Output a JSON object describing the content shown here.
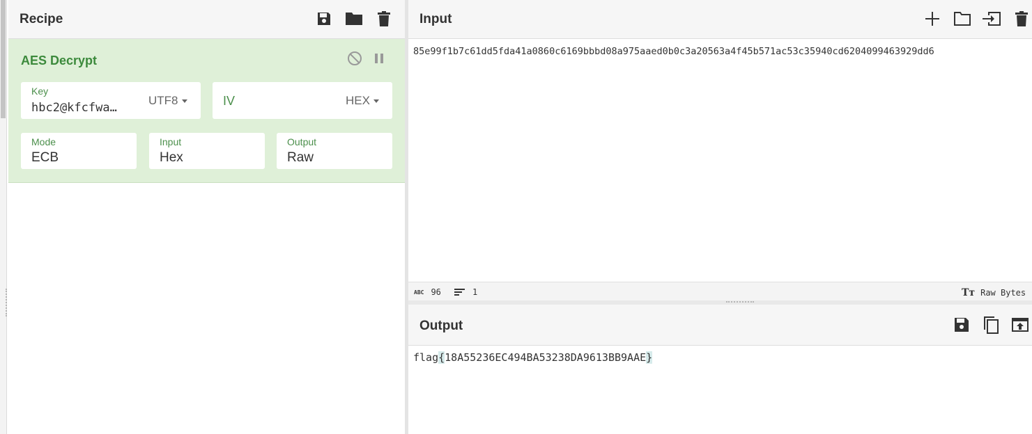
{
  "recipe": {
    "title": "Recipe",
    "icons": [
      "save-icon",
      "folder-icon",
      "trash-icon"
    ],
    "operation": {
      "title": "AES Decrypt",
      "key": {
        "label": "Key",
        "value": "hbc2@kfcfwa…",
        "encoding": "UTF8"
      },
      "iv": {
        "label": "IV",
        "encoding": "HEX"
      },
      "mode": {
        "label": "Mode",
        "value": "ECB"
      },
      "input": {
        "label": "Input",
        "value": "Hex"
      },
      "output": {
        "label": "Output",
        "value": "Raw"
      },
      "accent_color": "#3c8a3c",
      "background_color": "#dff0d8"
    }
  },
  "input": {
    "title": "Input",
    "text": "85e99f1b7c61dd5fda41a0860c6169bbbd08a975aaed0b0c3a20563a4f45b571ac53c35940cd6204099463929dd6",
    "icons": [
      "plus-icon",
      "folder-icon",
      "import-icon",
      "trash-icon"
    ],
    "status": {
      "chars": "96",
      "lines": "1",
      "encoding": "Raw Bytes"
    }
  },
  "output": {
    "title": "Output",
    "prefix": "flag",
    "open_brace": "{",
    "body": "18A55236EC494BA53238DA9613BB9AAE",
    "close_brace": "}",
    "icons": [
      "save-icon",
      "copy-icon",
      "open-in-input-icon"
    ]
  }
}
